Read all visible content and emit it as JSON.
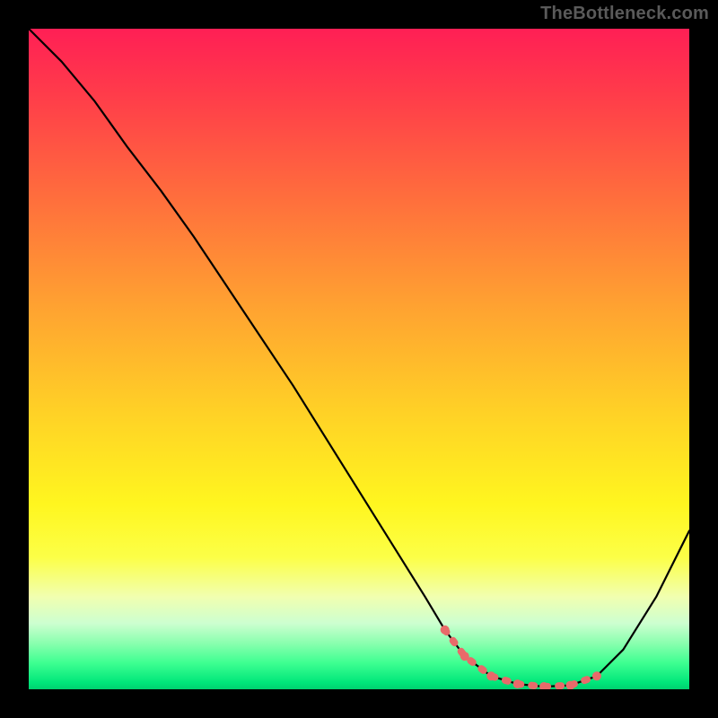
{
  "watermark": "TheBottleneck.com",
  "chart_data": {
    "type": "line",
    "title": "",
    "xlabel": "",
    "ylabel": "",
    "xlim": [
      0,
      100
    ],
    "ylim": [
      0,
      100
    ],
    "series": [
      {
        "name": "bottleneck-curve",
        "x": [
          0,
          5,
          10,
          15,
          20,
          25,
          30,
          35,
          40,
          45,
          50,
          55,
          60,
          63,
          66,
          70,
          74,
          78,
          82,
          86,
          90,
          95,
          100
        ],
        "y": [
          100,
          95,
          89,
          82,
          75.5,
          68.5,
          61,
          53.5,
          46,
          38,
          30,
          22,
          14,
          9,
          5,
          2,
          0.8,
          0.4,
          0.6,
          2,
          6,
          14,
          24
        ]
      }
    ],
    "highlight_band": {
      "name": "optimal-zone",
      "x": [
        63,
        66,
        70,
        74,
        78,
        82,
        86
      ],
      "y": [
        9,
        5,
        2,
        0.8,
        0.4,
        0.6,
        2
      ]
    }
  },
  "colors": {
    "curve": "#000000",
    "highlight": "#e86a6a",
    "highlight_dot": "#e86a6a"
  }
}
